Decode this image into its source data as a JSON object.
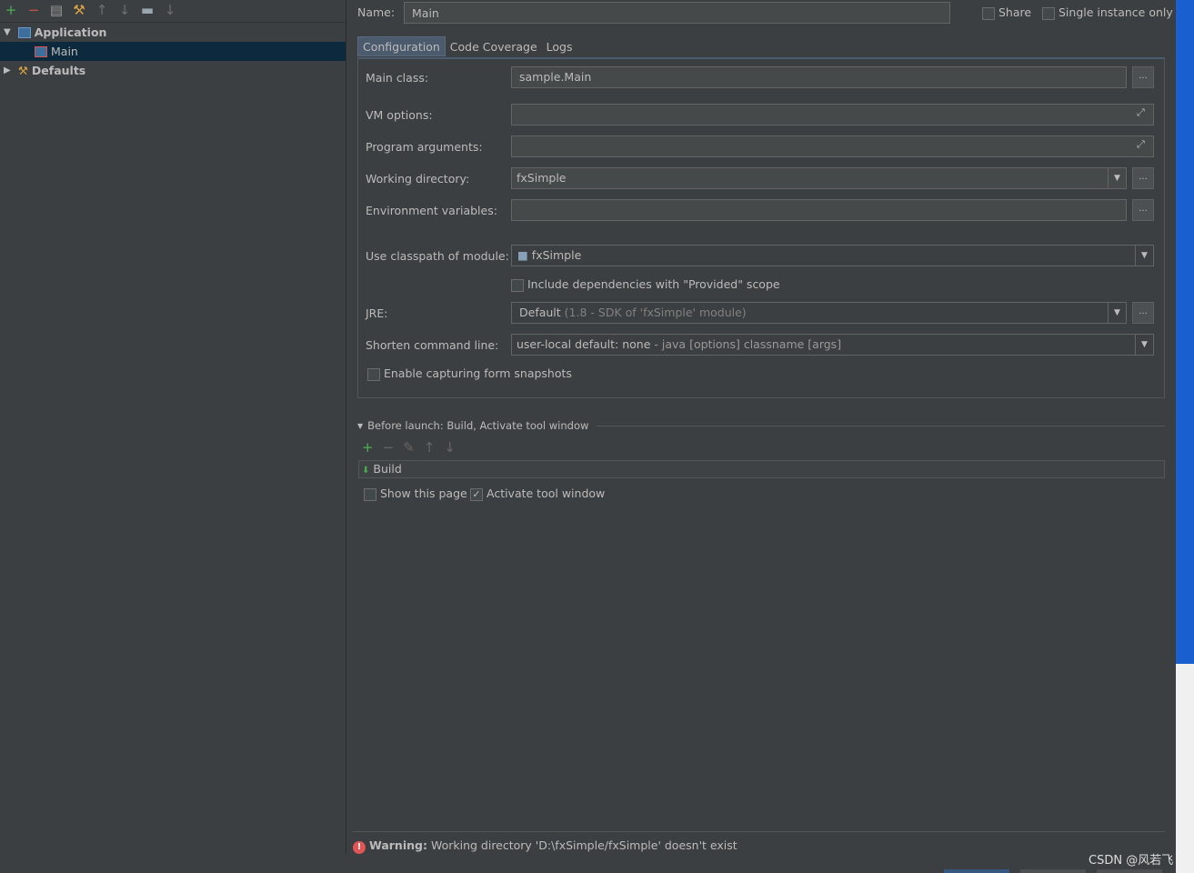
{
  "toolbar": {
    "icons": [
      "add-icon",
      "remove-icon",
      "copy-icon",
      "wrench-icon",
      "arrow-up-icon",
      "arrow-down-icon",
      "folder-icon",
      "sort-icon"
    ]
  },
  "tree": {
    "application": "Application",
    "main": "Main",
    "defaults": "Defaults"
  },
  "header": {
    "name_label": "Name:",
    "name_value": "Main",
    "share": "Share",
    "single_instance": "Single instance only"
  },
  "tabs": [
    "Configuration",
    "Code Coverage",
    "Logs"
  ],
  "form": {
    "main_class_label": "Main class:",
    "main_class": "sample.Main",
    "vm_label": "VM options:",
    "vm": "",
    "args_label": "Program arguments:",
    "args": "",
    "wd_label": "Working directory:",
    "wd": "fxSimple",
    "env_label": "Environment variables:",
    "env": "",
    "module_label": "Use classpath of module:",
    "module": "fxSimple",
    "include_deps": "Include dependencies with \"Provided\" scope",
    "jre_label": "JRE:",
    "jre": "Default",
    "jre_detail": "(1.8 - SDK of 'fxSimple' module)",
    "shorten_label": "Shorten command line:",
    "shorten": "user-local default: none",
    "shorten_detail": "- java [options] classname [args]",
    "snapshots": "Enable capturing form snapshots",
    "browse": "..."
  },
  "before_launch": {
    "title": "Before launch: Build, Activate tool window",
    "task": "Build",
    "show_page": "Show this page",
    "activate": "Activate tool window",
    "activate_checked": true
  },
  "warning": {
    "label": "Warning:",
    "text": "Working directory 'D:\\fxSimple/fxSimple' doesn't exist"
  },
  "watermark": "CSDN @风若飞"
}
